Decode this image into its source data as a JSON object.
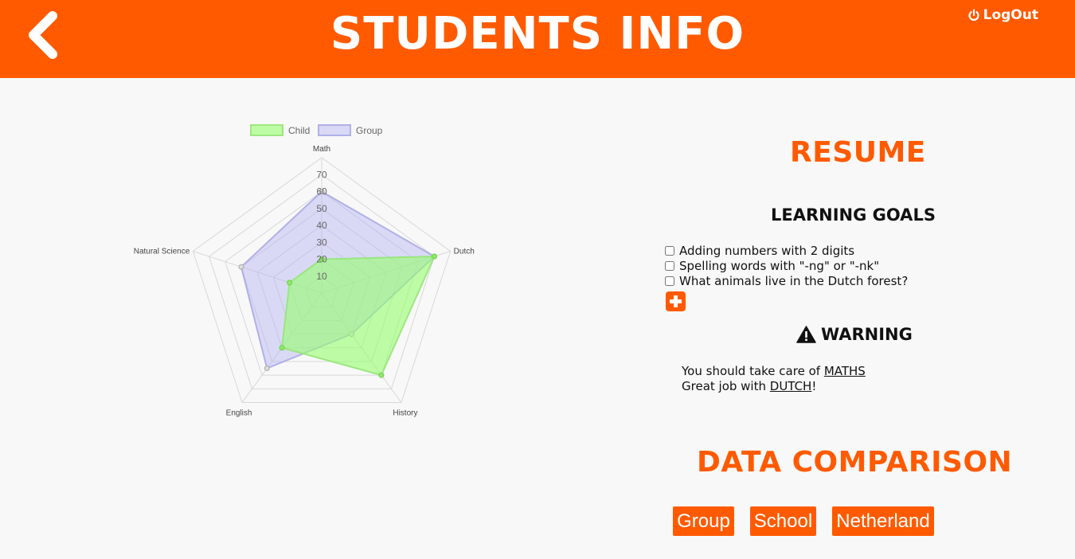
{
  "header": {
    "title": "STUDENTS INFO",
    "logout_label": "LogOut",
    "accent_color": "#ff5a00",
    "back_icon": "chevron-left-icon",
    "logout_icon": "power-icon"
  },
  "resume": {
    "title": "RESUME",
    "learning_goals_title": "LEARNING GOALS",
    "goals": [
      {
        "label": "Adding numbers with 2 digits",
        "checked": false
      },
      {
        "label": "Spelling words with \"-ng\" or \"-nk\"",
        "checked": false
      },
      {
        "label": "What animals live in the Dutch forest?",
        "checked": false
      }
    ],
    "add_icon": "plus-icon",
    "warning_title": "WARNING",
    "warning_icon": "warning-triangle-icon",
    "warning_line1_prefix": "You should take care of ",
    "warning_line1_link": "MATHS",
    "warning_line2_prefix": "Great job with ",
    "warning_line2_link": "DUTCH",
    "warning_line2_suffix": "!"
  },
  "comparison": {
    "title": "DATA COMPARISON",
    "buttons": [
      "Group",
      "School",
      "Netherland"
    ]
  },
  "chart_data": {
    "type": "radar",
    "categories": [
      "Math",
      "Dutch",
      "History",
      "English",
      "Natural Science"
    ],
    "series": [
      {
        "name": "Child",
        "values": [
          20,
          70,
          60,
          40,
          20
        ],
        "color": "#b0ff90"
      },
      {
        "name": "Group",
        "values": [
          60,
          70,
          30,
          55,
          50
        ],
        "color": "#c8c8f5"
      }
    ],
    "ticks": [
      10,
      20,
      30,
      40,
      50,
      60,
      70
    ],
    "rmax": 80,
    "legend_position": "top"
  }
}
